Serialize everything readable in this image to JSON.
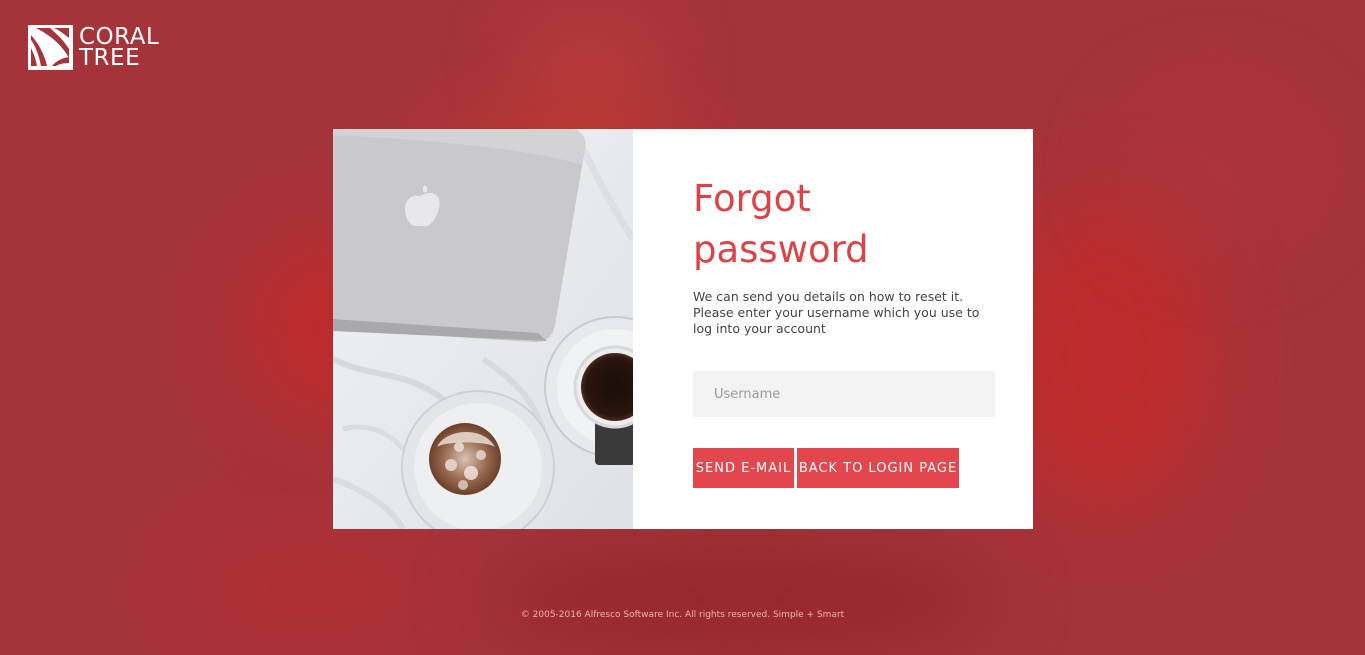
{
  "brand": {
    "line1": "CORAL",
    "line2": "TREE"
  },
  "form": {
    "title_line1": "Forgot",
    "title_line2": "password",
    "description": "We can send you details on how to reset it. Please enter your username which you use to log into your account",
    "username_placeholder": "Username",
    "username_value": "",
    "send_label": "SEND E-MAIL",
    "back_label": "BACK TO LOGIN PAGE"
  },
  "footer": {
    "text": "© 2005-2016 Alfresco Software Inc. All rights reserved. Simple + Smart"
  },
  "colors": {
    "background": "#a5343a",
    "accent": "#e3464c",
    "title": "#dc4347",
    "input_bg": "#f3f3f3"
  },
  "icons": {
    "logo": "coral-tree-logo-icon",
    "photo": "laptop-coffee-cake-photo"
  }
}
